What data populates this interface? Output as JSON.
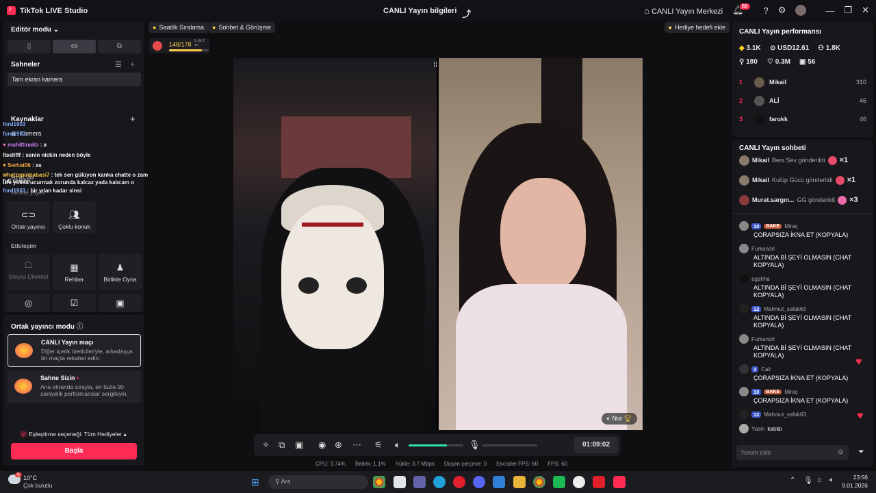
{
  "titlebar": {
    "app_name": "TikTok LIVE Studio",
    "center_title": "CANLI Yayın bilgileri",
    "live_center": "CANLI Yayın Merkezi",
    "notif_count": "88"
  },
  "left": {
    "editor_mode": "Editör modu",
    "scenes_title": "Sahneler",
    "scene_item": "Tam ekran kamera",
    "sources_title": "Kaynaklar",
    "source_camera": "Kamera",
    "tools_title": "Araçlar",
    "tools_subtitle": "Birlikte yayın",
    "tool_cohost": "Ortak yayıncı",
    "tool_multiguest": "Çoklu konuk",
    "interaction_title": "Etkileşim",
    "tool_viewer_requests": "İzleyici Dilekleri",
    "tool_guide": "Rehber",
    "tool_play_together": "Birlikte Oyna"
  },
  "overlay_chat": [
    {
      "name": "ford1903",
      "text": ""
    },
    {
      "name": "ford1903",
      "text": ""
    },
    {
      "name": "muhittinakb",
      "text": ": a"
    },
    {
      "name": "ltselifff",
      "text": ": senin nickin neden böyle"
    },
    {
      "name": "Serhat06",
      "text": ": as"
    },
    {
      "name": "whatzapinbabasi7",
      "text": ": tek sen gülüyon kanka chatte o zaman yazmayı bırak dostum sadece full screen"
    },
    {
      "name": "",
      "text": "izle yoksa ucurmak zorunda kalcaz yada kalıcam o"
    },
    {
      "name": "ford1903",
      "text": ": bir yılan kadar sinsi"
    }
  ],
  "cohost_mode": {
    "title": "Ortak yayıncı modu",
    "card1_title": "CANLI Yayın maçı",
    "card1_desc": "Diğer içerik üreticileriyle, arkadaşça bir maçta rekabet edin.",
    "card2_title": "Sahne Sizin",
    "card2_desc": "Ana ekranda sırayla, en fazla 90 saniyelik performanslar sergileyin.",
    "matching": "Eşleştirme seçeneği: Tüm Hediyeler",
    "go_live": "Başla"
  },
  "stage": {
    "ranking_btn": "Saatlik Sıralama",
    "chat_meet_btn": "Sohbet & Görüşme",
    "gift_goal_btn": "Hediye hedefi ekle",
    "goal_progress": "148/178",
    "goal_fraction": 0.83,
    "goal_timer": "1 dk 2 sn",
    "guest_name": "Nur",
    "timer": "01:09:02",
    "volume_level": 0.7
  },
  "stats": {
    "cpu": "CPU: 3.74%",
    "memory": "Bellek: 1.1%",
    "upload": "Yükle: 3.7 Mbps",
    "dropped": "Düşen çerçeve: 0",
    "encoder_fps": "Encoder FPS: 60",
    "fps": "FPS: 60"
  },
  "performance": {
    "title": "CANLI Yayın performansı",
    "diamonds": "3.1K",
    "usd": "USD12.61",
    "followers": "1.8K",
    "viewers": "180",
    "likes": "0.3M",
    "count": "56",
    "ranking": [
      {
        "rank": "1",
        "name": "Mikail",
        "score": "310"
      },
      {
        "rank": "2",
        "name": "ALİ",
        "score": "46"
      },
      {
        "rank": "3",
        "name": "farukk",
        "score": "46"
      }
    ]
  },
  "chat": {
    "title": "CANLI Yayın sohbeti",
    "gifts": [
      {
        "name": "Mikail",
        "text": "Beni Sev gönderildi",
        "qty": "×1"
      },
      {
        "name": "Mikail",
        "text": "Kulüp Gücü gönderildi",
        "qty": "×1"
      },
      {
        "name": "Murat.sargın...",
        "text": "GG gönderildi",
        "qty": "×3"
      }
    ],
    "messages": [
      {
        "level": "10",
        "badge": "BAKE",
        "name": "Miraç",
        "text": "ÇORAPSIZA İKNA ET (KOPYALA)"
      },
      {
        "level": "",
        "badge": "",
        "name": "Furkandrl",
        "text": "ALTINDA Bİ ŞEYİ OLMASIN (CHAT KOPYALA)"
      },
      {
        "level": "",
        "badge": "",
        "name": "agahha",
        "text": "ALTINDA Bİ ŞEYİ OLMASIN (CHAT KOPYALA)"
      },
      {
        "level": "12",
        "badge": "",
        "name": "Mahmut_safak63",
        "text": "ALTINDA Bİ ŞEYİ OLMASIN (CHAT KOPYALA)"
      },
      {
        "level": "",
        "badge": "",
        "name": "Furkandrl",
        "text": "ALTINDA Bİ ŞEYİ OLMASIN (CHAT KOPYALA)"
      },
      {
        "level": "3",
        "badge": "",
        "name": "Cali",
        "text": "ÇORAPSIZA İKNA ET (KOPYALA)"
      },
      {
        "level": "10",
        "badge": "BAKE",
        "name": "Miraç",
        "text": "ÇORAPSIZA İKNA ET (KOPYALA)"
      },
      {
        "level": "12",
        "badge": "",
        "name": "Mahmut_safak63",
        "text": ""
      }
    ],
    "joined_name": "Yasin",
    "joined_text": "katıldı",
    "input_placeholder": "Yorum ekle"
  },
  "taskbar": {
    "weather_temp": "10°C",
    "weather_desc": "Çok bulutlu",
    "weather_badge": "6",
    "search": "Ara",
    "time": "23:56",
    "date": "9.01.2026"
  }
}
